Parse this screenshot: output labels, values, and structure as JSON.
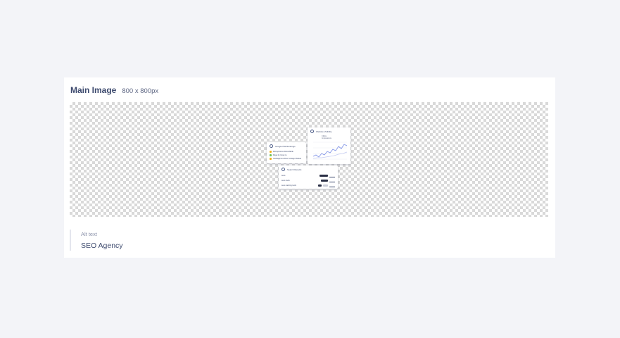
{
  "card": {
    "title": "Main Image",
    "dimensions": "800 x 800px"
  },
  "preview": {
    "cards": {
      "performance": {
        "title": "Google PW Rankings",
        "rows": [
          {
            "label": "Microphones Recordable",
            "color": "#f2b01e"
          },
          {
            "label": "Page by Grow to",
            "color": "#6ac259"
          },
          {
            "label": "Cartilaginous Dive Cottage Module",
            "color": "#f2b01e"
          }
        ]
      },
      "ranking": {
        "title": "Website Visibility",
        "legend": "Clicks  Impressions"
      },
      "keywords": {
        "title": "Search Results",
        "rows": [
          {
            "label": "seos"
          },
          {
            "label": "seos tools"
          },
          {
            "label": "seos ranking tools"
          }
        ]
      }
    }
  },
  "alt": {
    "label": "Alt text",
    "value": "SEO Agency"
  },
  "colors": {
    "background": "#f3f4f8",
    "card": "#ffffff",
    "text": "#3d4a6e",
    "muted": "#8b92aa",
    "chart_line": "#7b8fe6"
  }
}
